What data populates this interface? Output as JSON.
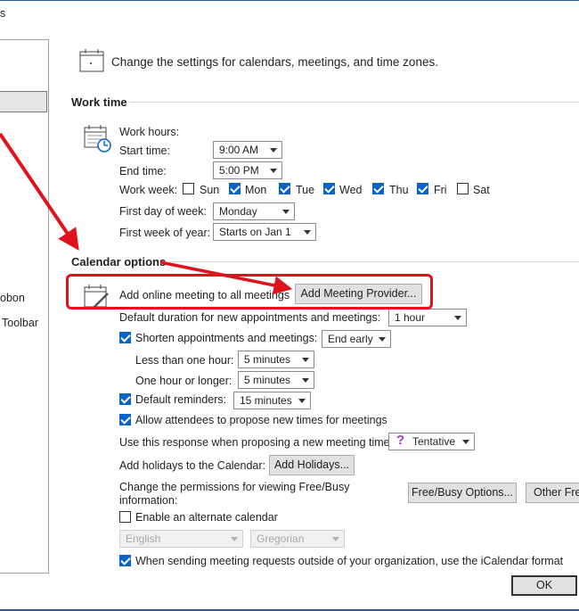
{
  "window": {
    "title_fragment": "s"
  },
  "sidebar": {
    "items": [
      "obon",
      "Toolbar"
    ]
  },
  "header": {
    "text": "Change the settings for calendars, meetings, and time zones."
  },
  "work_time": {
    "title": "Work time",
    "work_hours_label": "Work hours:",
    "start_label": "Start time:",
    "start_value": "9:00 AM",
    "end_label": "End time:",
    "end_value": "5:00 PM",
    "week_label": "Work week:",
    "days": [
      {
        "label": "Sun",
        "checked": false
      },
      {
        "label": "Mon",
        "checked": true
      },
      {
        "label": "Tue",
        "checked": true
      },
      {
        "label": "Wed",
        "checked": true
      },
      {
        "label": "Thu",
        "checked": true
      },
      {
        "label": "Fri",
        "checked": true
      },
      {
        "label": "Sat",
        "checked": false
      }
    ],
    "first_day_label": "First day of week:",
    "first_day_value": "Monday",
    "first_week_label": "First week of year:",
    "first_week_value": "Starts on Jan 1"
  },
  "calendar_options": {
    "title": "Calendar options",
    "online_meeting_label": "Add online meeting to all meetings",
    "add_provider_button": "Add Meeting Provider...",
    "default_duration_label": "Default duration for new appointments and meetings:",
    "default_duration_value": "1 hour",
    "shorten_label": "Shorten appointments and meetings:",
    "shorten_value": "End early",
    "less_hour_label": "Less than one hour:",
    "less_hour_value": "5 minutes",
    "hour_longer_label": "One hour or longer:",
    "hour_longer_value": "5 minutes",
    "reminders_label": "Default reminders:",
    "reminders_value": "15 minutes",
    "allow_propose_label": "Allow attendees to propose new times for meetings",
    "propose_response_label": "Use this response when proposing a new meeting time:",
    "propose_response_value": "Tentative",
    "holidays_label": "Add holidays to the Calendar:",
    "holidays_button": "Add Holidays...",
    "freebusy_label_1": "Change the permissions for viewing Free/Busy",
    "freebusy_label_2": "information:",
    "freebusy_button": "Free/Busy Options...",
    "other_freebusy_button": "Other Fre",
    "alternate_label": "Enable an alternate calendar",
    "alt_language_value": "English",
    "alt_type_value": "Gregorian",
    "icalendar_label": "When sending meeting requests outside of your organization, use the iCalendar format"
  },
  "footer": {
    "ok_button": "OK"
  },
  "colors": {
    "accent": "#0a64c8",
    "annotation": "#e0121b"
  }
}
